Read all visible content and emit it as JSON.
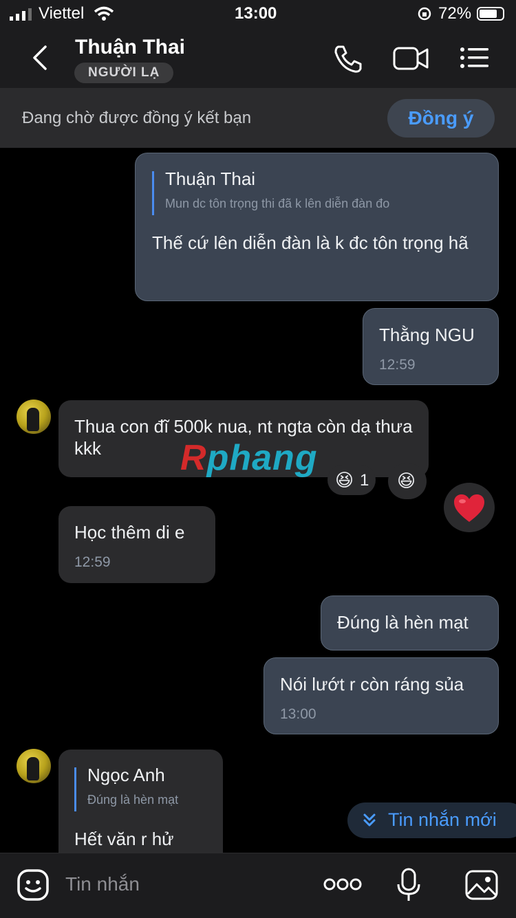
{
  "status": {
    "carrier": "Viettel",
    "time": "13:00",
    "battery": "72%"
  },
  "header": {
    "title": "Thuận Thai",
    "badge": "NGƯỜI LẠ"
  },
  "friend_request": {
    "text": "Đang chờ được đồng ý kết bạn",
    "button": "Đồng ý"
  },
  "messages": [
    {
      "quote_name": "Thuận Thai",
      "quote_text": "Mun dc tôn trọng thi đã k lên diễn đàn đo",
      "text": "Thế cứ lên diễn đàn là k đc tôn trọng hã"
    },
    {
      "text": "Thằng NGU",
      "time": "12:59"
    },
    {
      "text": "Thua con đĩ 500k nua, nt ngta còn dạ thưa kkk",
      "reaction_count": "1"
    },
    {
      "text": "Học thêm di e",
      "time": "12:59"
    },
    {
      "text": "Đúng là hèn mạt"
    },
    {
      "text": "Nói lướt r còn ráng sủa",
      "time": "13:00"
    },
    {
      "quote_name": "Ngọc Anh",
      "quote_text": "Đúng là hèn mạt",
      "text": "Hết văn r hử"
    }
  ],
  "watermark": "Rphang",
  "new_messages_button": "Tin nhắn mới",
  "input": {
    "placeholder": "Tin nhắn"
  }
}
